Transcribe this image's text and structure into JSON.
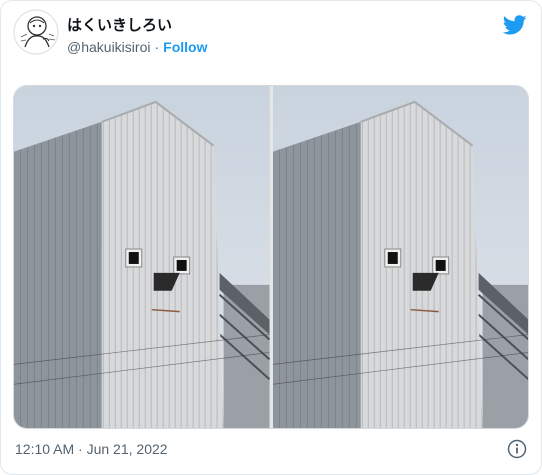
{
  "tweet": {
    "display_name": "はくいきしろい",
    "handle": "@hakuikisiroi",
    "separator": "·",
    "follow_label": "Follow",
    "timestamp": "12:10 AM · Jun 21, 2022"
  },
  "icons": {
    "brand": "twitter-bird-icon",
    "info": "info-icon",
    "avatar": "avatar-sketch-icon"
  },
  "colors": {
    "accent": "#1d9bf0",
    "text": "#0f1419",
    "muted": "#536471",
    "border": "#e1e8ed"
  },
  "media": {
    "photos": [
      {
        "id": "photo-left"
      },
      {
        "id": "photo-right"
      }
    ]
  }
}
